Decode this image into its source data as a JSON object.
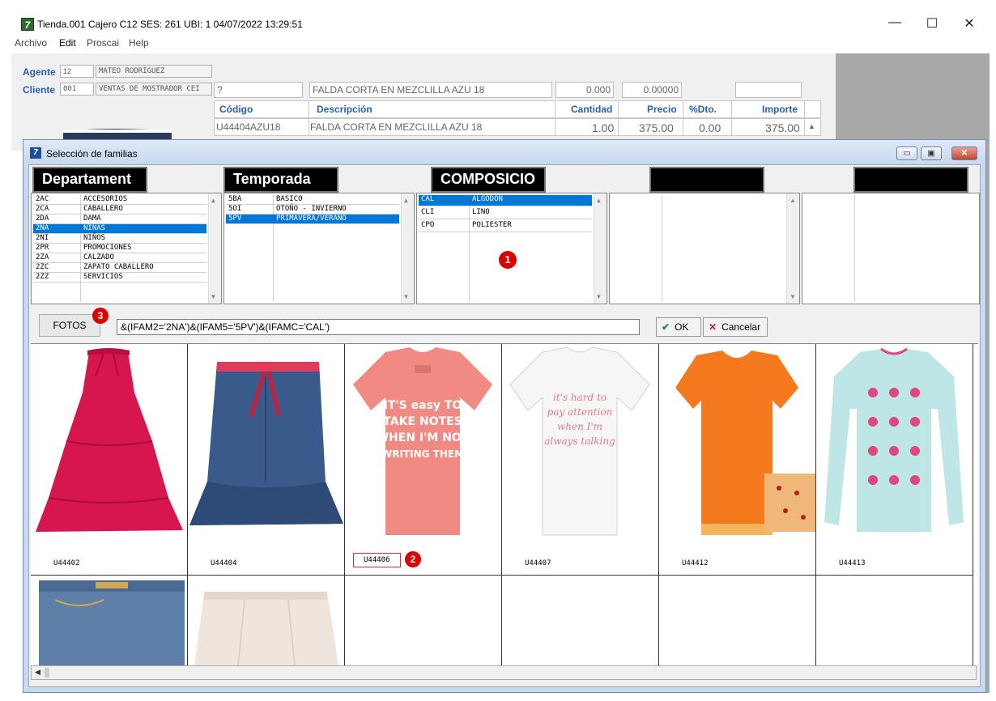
{
  "window": {
    "title": "Tienda.001  Cajero C12    SES: 261   UBI: 1   04/07/2022 13:29:51",
    "icon_label": "7",
    "controls": [
      "minimize-icon",
      "maximize-icon",
      "close-icon"
    ]
  },
  "menu": [
    "Archivo",
    "Edit",
    "Proscai",
    "Help"
  ],
  "form": {
    "agente_label": "Agente",
    "agente_code": "12",
    "agente_name": "MATEO RODRIGUEZ",
    "cliente_label": "Cliente",
    "cliente_code": "001",
    "cliente_name": "VENTAS DE MOSTRADOR CEI",
    "line_code": "?",
    "line_desc": "FALDA CORTA EN MEZCLILLA AZU 18",
    "line_qty": "0.000",
    "line_price": "0.00000",
    "line_extra": ""
  },
  "grid": {
    "headers": [
      "Código",
      "Descripción",
      "Cantidad",
      "Precio",
      "%Dto.",
      "Importe"
    ],
    "rows": [
      [
        "U44404AZU18",
        "FALDA CORTA EN MEZCLILLA AZU 18",
        "1.00",
        "375.00",
        "0.00",
        "375.00"
      ]
    ]
  },
  "dialog": {
    "title": "Selección de familias",
    "icon_label": "7",
    "headers": [
      "Departament",
      "Temporada",
      "COMPOSICIO",
      "",
      ""
    ],
    "departamentos": [
      {
        "code": "2AC",
        "desc": "ACCESORIOS"
      },
      {
        "code": "2CA",
        "desc": "CABALLERO"
      },
      {
        "code": "2DA",
        "desc": "DAMA"
      },
      {
        "code": "2NA",
        "desc": "NIÑAS"
      },
      {
        "code": "2NI",
        "desc": "NIÑOS"
      },
      {
        "code": "2PR",
        "desc": "PROMOCIONES"
      },
      {
        "code": "2ZA",
        "desc": "CALZADO"
      },
      {
        "code": "2ZC",
        "desc": "ZAPATO CABALLERO"
      },
      {
        "code": "2ZZ",
        "desc": "SERVICIOS"
      }
    ],
    "departamento_selected": 3,
    "temporadas": [
      {
        "code": "5BA",
        "desc": "BASICO"
      },
      {
        "code": "5OI",
        "desc": "OTOÑO - INVIERNO"
      },
      {
        "code": "5PV",
        "desc": "PRIMAVERA/VERANO"
      }
    ],
    "temporada_selected": 2,
    "composiciones": [
      {
        "code": "CAL",
        "desc": "ALGODON"
      },
      {
        "code": "CLI",
        "desc": "LINO"
      },
      {
        "code": "CPO",
        "desc": "POLIESTER"
      }
    ],
    "composicion_selected": 0,
    "marker_1": "1",
    "marker_2": "2",
    "marker_3": "3",
    "fotos_label": "FOTOS",
    "filter": "&(IFAM2='2NA')&(IFAM5='5PV')&(IFAMC='CAL')",
    "ok_label": "OK",
    "cancel_label": "Cancelar",
    "products": [
      {
        "code": "U44402",
        "kind": "red-skirt"
      },
      {
        "code": "U44404",
        "kind": "denim-skirt"
      },
      {
        "code": "U44406",
        "kind": "pink-tshirt",
        "selected": true
      },
      {
        "code": "U44407",
        "kind": "white-tshirt"
      },
      {
        "code": "U44412",
        "kind": "orange-tshirt"
      },
      {
        "code": "U44413",
        "kind": "butterfly-longsleeve"
      },
      {
        "code": "",
        "kind": "jeans"
      },
      {
        "code": "",
        "kind": "beige-skirt"
      }
    ],
    "tshirt_texts": {
      "pink": [
        "IT'S easy TO",
        "TAKE NOTES",
        "WHEN I'M NOT",
        "WRITING THEM"
      ],
      "white": [
        "it's hard to",
        "pay attention",
        "when I'm",
        "always talking"
      ]
    }
  }
}
